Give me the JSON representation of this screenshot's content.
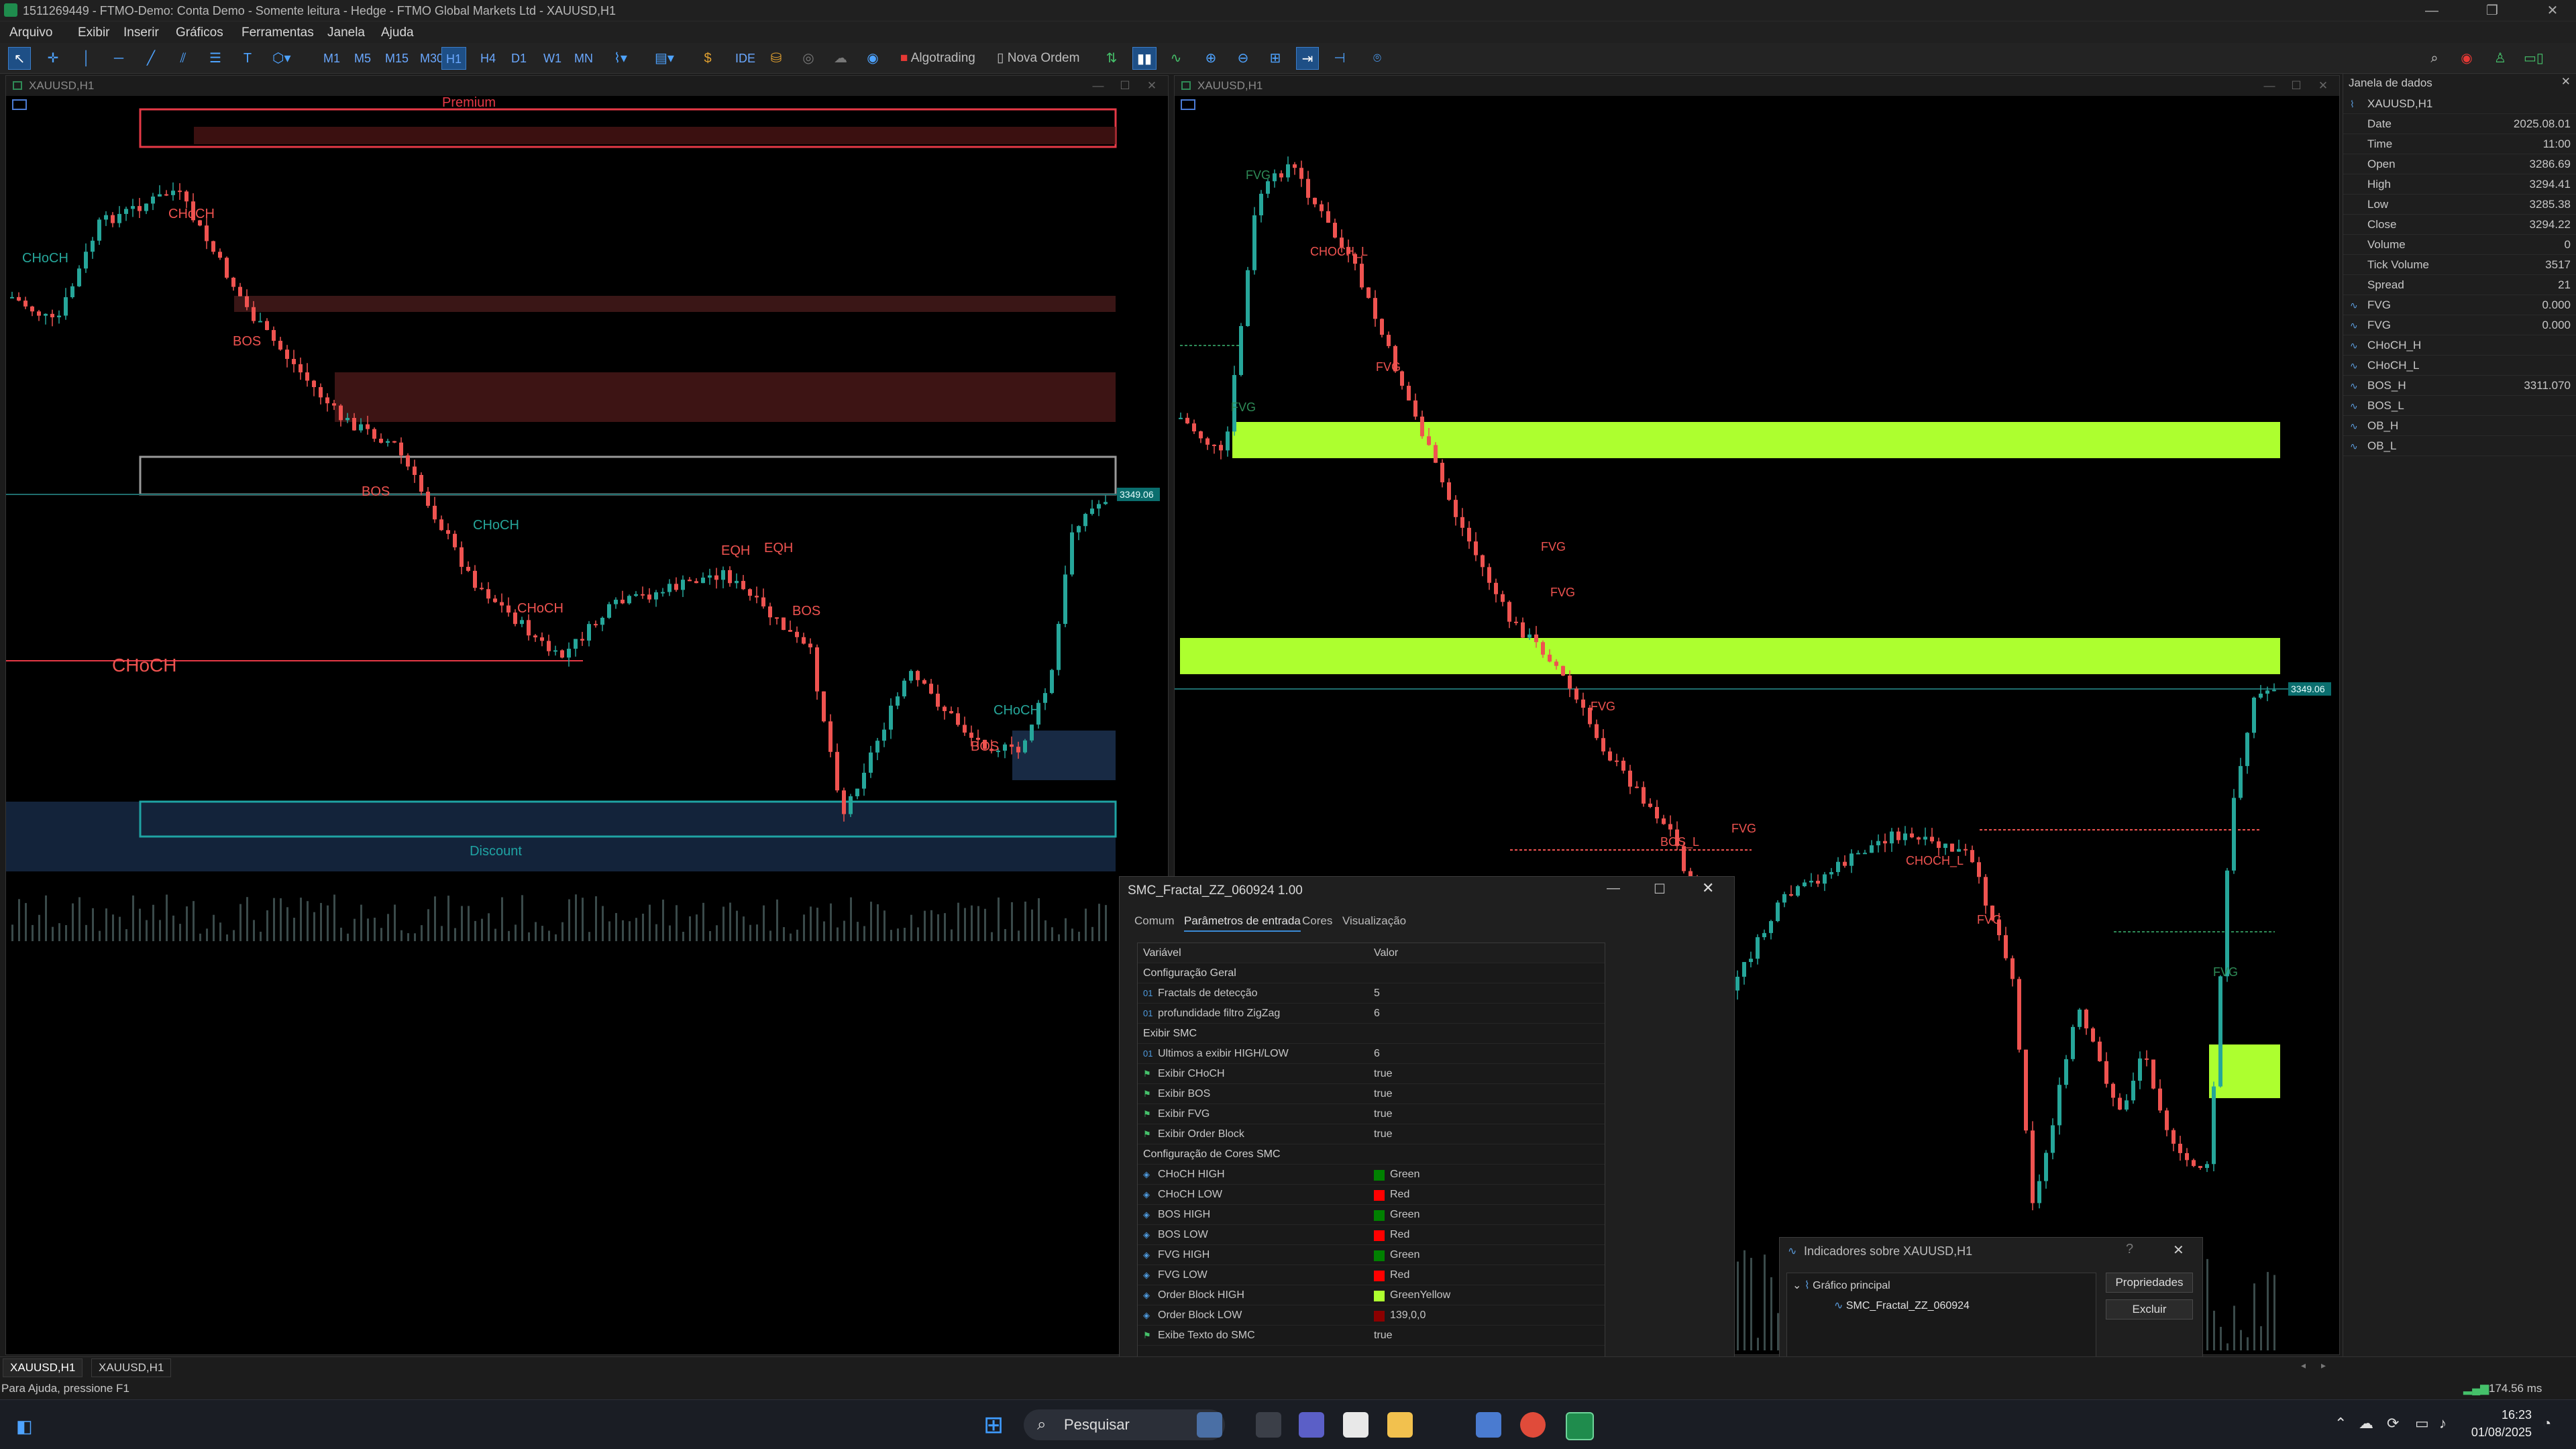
{
  "window": {
    "title": "1511269449 - FTMO-Demo: Conta Demo - Somente leitura - Hedge - FTMO Global Markets Ltd - XAUUSD,H1"
  },
  "menu": [
    "Arquivo",
    "Exibir",
    "Inserir",
    "Gráficos",
    "Ferramentas",
    "Janela",
    "Ajuda"
  ],
  "toolbar": {
    "timeframes": [
      "M1",
      "M5",
      "M15",
      "M30",
      "H1",
      "H4",
      "D1",
      "W1",
      "MN"
    ],
    "selected_timeframe": "H1",
    "ide_label": "IDE",
    "algotrading_label": "Algotrading",
    "new_order_label": "Nova Ordem"
  },
  "chart_left": {
    "title": "XAUUSD,H1",
    "price_tag": "3349.06",
    "labels": {
      "premium": "Premium",
      "discount": "Discount",
      "choch_top_left": "CHoCH",
      "choch_top": "CHoCH",
      "bos1": "BOS",
      "bos2": "BOS",
      "choch_mid": "CHoCH",
      "choch_mid2": "CHoCH",
      "eqh1": "EQH",
      "eqh2": "EQH",
      "bos3": "BOS",
      "choch_big": "CHoCH",
      "choch_low": "CHoCH",
      "bos4": "BOS"
    }
  },
  "chart_right": {
    "title": "XAUUSD,H1",
    "price_tag": "3349.06",
    "labels": {
      "fvg1": "FVG",
      "choch_l1": "CHOCH_L",
      "fvg2": "FVG",
      "fvg3": "FVG",
      "fvg4": "FVG",
      "fvg5": "FVG",
      "bos_l": "BOS_L",
      "fvg6": "FVG",
      "choch_l2": "CHOCH_L",
      "fvg7": "FVG",
      "fvg8": "FVG"
    }
  },
  "data_window": {
    "title": "Janela de dados",
    "symbol": "XAUUSD,H1",
    "rows": [
      {
        "key": "Date",
        "value": "2025.08.01"
      },
      {
        "key": "Time",
        "value": "11:00"
      },
      {
        "key": "Open",
        "value": "3286.69"
      },
      {
        "key": "High",
        "value": "3294.41"
      },
      {
        "key": "Low",
        "value": "3285.38"
      },
      {
        "key": "Close",
        "value": "3294.22"
      },
      {
        "key": "Volume",
        "value": "0"
      },
      {
        "key": "Tick Volume",
        "value": "3517"
      },
      {
        "key": "Spread",
        "value": "21"
      }
    ],
    "indicators": [
      {
        "key": "FVG",
        "value": "0.000"
      },
      {
        "key": "FVG",
        "value": "0.000"
      },
      {
        "key": "CHoCH_H",
        "value": ""
      },
      {
        "key": "CHoCH_L",
        "value": ""
      },
      {
        "key": "BOS_H",
        "value": "3311.070"
      },
      {
        "key": "BOS_L",
        "value": ""
      },
      {
        "key": "OB_H",
        "value": ""
      },
      {
        "key": "OB_L",
        "value": ""
      }
    ]
  },
  "dialog": {
    "title": "SMC_Fractal_ZZ_060924 1.00",
    "tabs": [
      "Comum",
      "Parâmetros de entrada",
      "Cores",
      "Visualização"
    ],
    "active_tab": "Parâmetros de entrada",
    "columns": [
      "Variável",
      "Valor"
    ],
    "rows": [
      {
        "type": "section",
        "name": "Configuração Geral"
      },
      {
        "type": "int",
        "icon": "01",
        "name": "Fractals de detecção",
        "value": "5"
      },
      {
        "type": "int",
        "icon": "01",
        "name": "profundidade filtro ZigZag",
        "value": "6"
      },
      {
        "type": "section",
        "name": "Exibir SMC"
      },
      {
        "type": "int",
        "icon": "01",
        "name": "Ultimos a exibir HIGH/LOW",
        "value": "6"
      },
      {
        "type": "bool",
        "icon": "⚑",
        "name": "Exibir CHoCH",
        "value": "true"
      },
      {
        "type": "bool",
        "icon": "⚑",
        "name": "Exibir BOS",
        "value": "true"
      },
      {
        "type": "bool",
        "icon": "⚑",
        "name": "Exibir FVG",
        "value": "true"
      },
      {
        "type": "bool",
        "icon": "⚑",
        "name": "Exibir Order Block",
        "value": "true"
      },
      {
        "type": "section",
        "name": "Configuração de Cores SMC"
      },
      {
        "type": "color",
        "icon": "◈",
        "name": "CHoCH HIGH",
        "value": "Green",
        "color": "#008000"
      },
      {
        "type": "color",
        "icon": "◈",
        "name": "CHoCH LOW",
        "value": "Red",
        "color": "#ff0000"
      },
      {
        "type": "color",
        "icon": "◈",
        "name": "BOS HIGH",
        "value": "Green",
        "color": "#008000"
      },
      {
        "type": "color",
        "icon": "◈",
        "name": "BOS LOW",
        "value": "Red",
        "color": "#ff0000"
      },
      {
        "type": "color",
        "icon": "◈",
        "name": "FVG HIGH",
        "value": "Green",
        "color": "#008000"
      },
      {
        "type": "color",
        "icon": "◈",
        "name": "FVG LOW",
        "value": "Red",
        "color": "#ff0000"
      },
      {
        "type": "color",
        "icon": "◈",
        "name": "Order Block HIGH",
        "value": "GreenYellow",
        "color": "#adff2f"
      },
      {
        "type": "color",
        "icon": "◈",
        "name": "Order Block LOW",
        "value": "139,0,0",
        "color": "#8b0000"
      },
      {
        "type": "bool",
        "icon": "⚑",
        "name": "Exibe Texto do SMC",
        "value": "true"
      }
    ]
  },
  "indicators_dialog": {
    "title": "Indicadores sobre XAUUSD,H1",
    "tree_root": "Gráfico principal",
    "tree_child": "SMC_Fractal_ZZ_060924",
    "properties_button": "Propriedades",
    "delete_button": "Excluir"
  },
  "bottom_tabs": [
    "XAUUSD,H1",
    "XAUUSD,H1"
  ],
  "status": {
    "help": "Para Ajuda, pressione F1",
    "ping": "174.56 ms"
  },
  "taskbar": {
    "search_placeholder": "Pesquisar",
    "time": "16:23",
    "date": "01/08/2025"
  },
  "colors": {
    "bull": "#26a69a",
    "bear": "#ef5350",
    "order_block": "#adff2f",
    "accent": "#3a8ad6"
  }
}
